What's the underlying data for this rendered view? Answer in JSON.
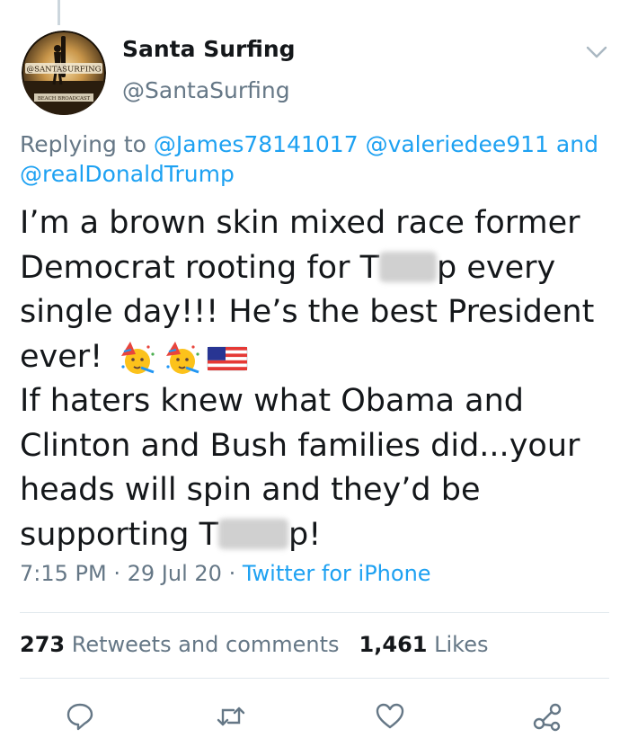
{
  "tweet": {
    "author": {
      "name": "Santa Surfing",
      "handle": "@SantaSurfing",
      "avatar_text_top": "@SANTASURFING",
      "avatar_text_bottom": "BEACH BROADCAST"
    },
    "replying_to": {
      "prefix": "Replying to",
      "mention_1": "@James78141017",
      "mention_2": "@valeriedee911",
      "conjunction": "and",
      "mention_3": "@realDonaldTrump"
    },
    "text": {
      "line_1": "I’m a brown skin mixed race former",
      "line_2_a": "Democrat rooting for T",
      "line_2_b": "p every",
      "line_3": "single day!!! He’s the best President",
      "line_4": "ever!",
      "line_5": "If haters knew what Obama and",
      "line_6": "Clinton and Bush families did...your",
      "line_7": "heads will spin and they’d be",
      "line_8_a": "supporting T",
      "line_8_b": "p!",
      "emojis": [
        "partying-face-emoji",
        "partying-face-emoji",
        "us-flag-emoji"
      ]
    },
    "time": "7:15 PM",
    "separator": "·",
    "date": "29 Jul 20",
    "source": "Twitter for iPhone",
    "stats": {
      "retweets_count": "273",
      "retweets_label": "Retweets and comments",
      "likes_count": "1,461",
      "likes_label": "Likes"
    },
    "actions": [
      "reply-icon",
      "retweet-icon",
      "like-icon",
      "share-icon"
    ]
  },
  "colors": {
    "text": "#14171a",
    "secondary": "#657786",
    "link": "#1da1f2",
    "divider": "#e1e8ed"
  }
}
